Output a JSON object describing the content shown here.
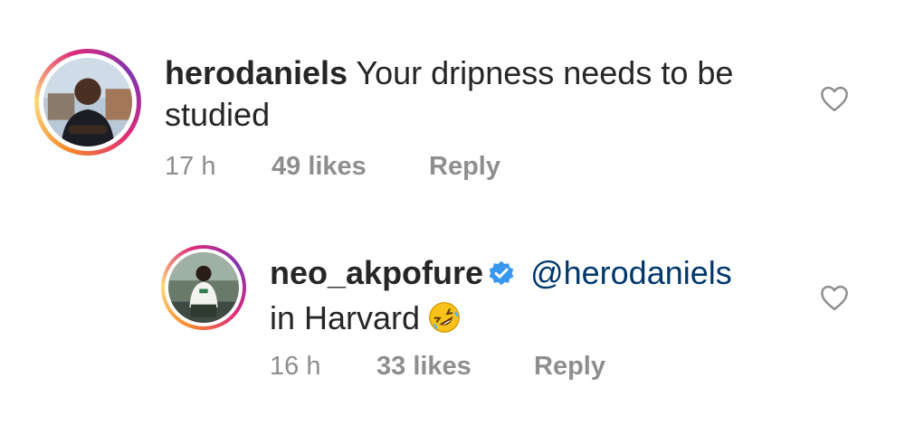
{
  "comments": [
    {
      "username": "herodaniels",
      "text_line1": "Your dripness needs to be",
      "text_line2": "studied",
      "time": "17 h",
      "likes": "49 likes",
      "reply": "Reply"
    },
    {
      "username": "neo_akpofure",
      "verified": true,
      "mention": "@herodaniels",
      "text_line2": "in Harvard",
      "emoji": "rolling-on-floor-laughing-emoji",
      "time": "16 h",
      "likes": "33 likes",
      "reply": "Reply"
    }
  ],
  "colors": {
    "text": "#262626",
    "meta": "#8e8e8e",
    "mention": "#00376b",
    "verified": "#3897f0"
  },
  "icons": [
    "heart-icon",
    "verified-icon"
  ]
}
